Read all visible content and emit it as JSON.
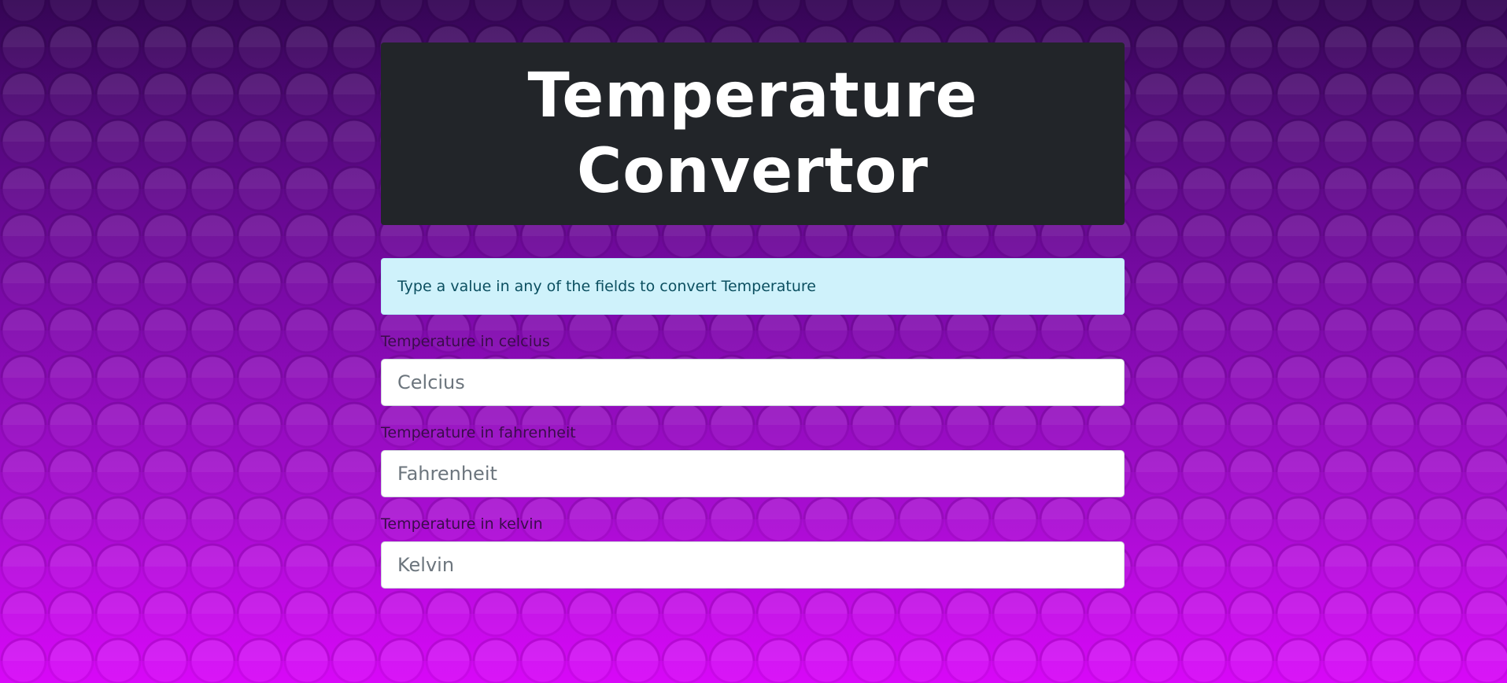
{
  "header": {
    "title_line1": "Temperature",
    "title_line2": "Convertor"
  },
  "info": {
    "message": "Type a value in any of the fields to convert Temperature"
  },
  "fields": [
    {
      "label": "Temperature in celcius",
      "placeholder": "Celcius",
      "value": ""
    },
    {
      "label": "Temperature in fahrenheit",
      "placeholder": "Fahrenheit",
      "value": ""
    },
    {
      "label": "Temperature in kelvin",
      "placeholder": "Kelvin",
      "value": ""
    }
  ],
  "colors": {
    "header_bg": "#222529",
    "info_bg": "#cff2fb",
    "background_top": "#340554",
    "background_bottom": "#d808f8"
  }
}
